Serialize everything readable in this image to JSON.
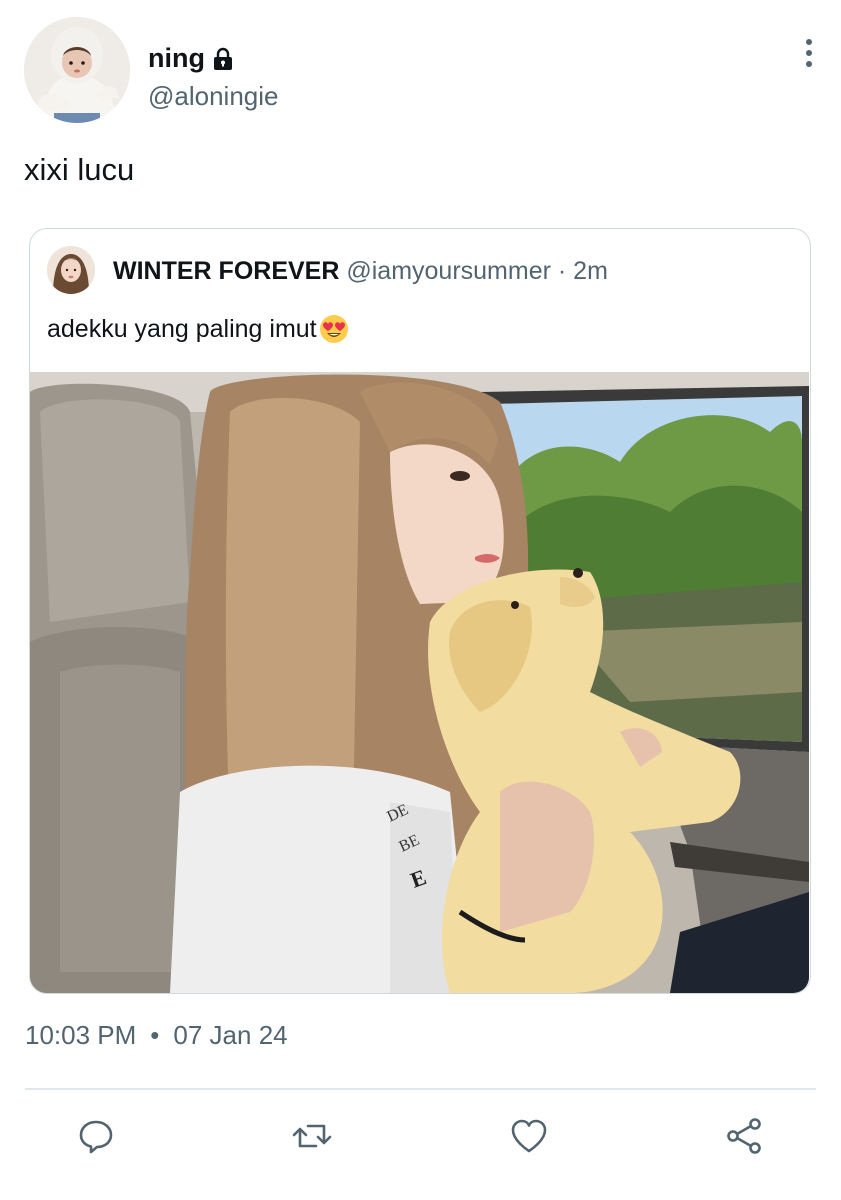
{
  "tweet": {
    "author": {
      "display_name": "ning",
      "handle": "@aloningie",
      "protected_icon": "lock-icon",
      "avatar_icon": "avatar"
    },
    "text": "xixi lucu",
    "timestamp": {
      "time": "10:03 PM",
      "separator": "•",
      "date": "07 Jan 24"
    }
  },
  "quote": {
    "display_name": "WINTER FOREVER",
    "handle": "@iamyoursummer",
    "separator": "·",
    "age": "2m",
    "text": "adekku yang paling imut",
    "emoji": "heart-eyes-emoji",
    "photo": "photo of a girl holding a plush dog in a car"
  },
  "actions": [
    {
      "name": "reply",
      "icon": "reply-icon"
    },
    {
      "name": "retweet",
      "icon": "retweet-icon"
    },
    {
      "name": "like",
      "icon": "heart-icon"
    },
    {
      "name": "share",
      "icon": "share-icon"
    }
  ],
  "colors": {
    "text_primary": "#0f1419",
    "text_secondary": "#536471",
    "border": "#cfd9de"
  }
}
